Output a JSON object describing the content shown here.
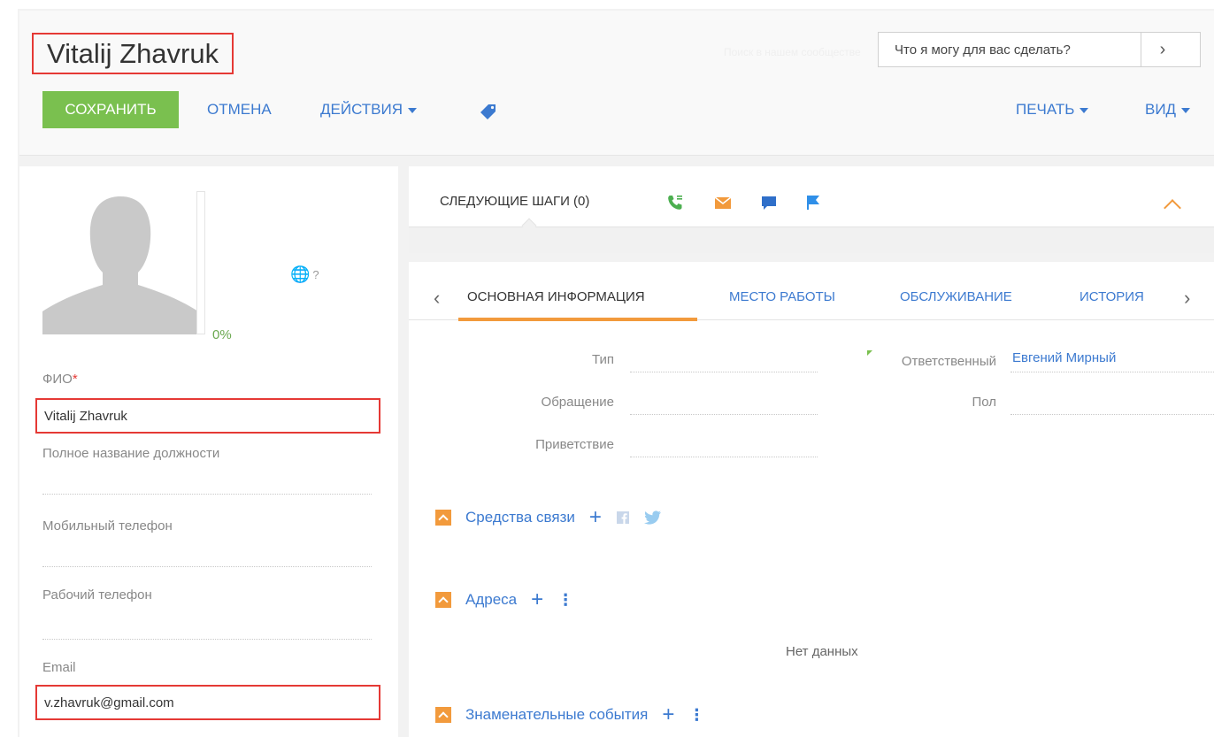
{
  "header": {
    "title": "Vitalij Zhavruk",
    "command_placeholder": "Что я могу для вас сделать?",
    "command_arrow": "›",
    "ghost_text": "Поиск в нашем сообществе",
    "save_label": "СОХРАНИТЬ",
    "cancel_label": "ОТМЕНА",
    "actions_label": "ДЕЙСТВИЯ",
    "print_label": "ПЕЧАТЬ",
    "view_label": "ВИД"
  },
  "profile": {
    "completeness": "0%",
    "completeness_fraction": 0,
    "timezone_hint": "?"
  },
  "left_fields": {
    "fio_label": "ФИО",
    "fio_required": "*",
    "fio_value": "Vitalij Zhavruk",
    "job_label": "Полное название должности",
    "mobile_label": "Мобильный телефон",
    "work_phone_label": "Рабочий телефон",
    "email_label": "Email",
    "email_value": "v.zhavruk@gmail.com"
  },
  "next_steps": {
    "title": "СЛЕДУЮЩИЕ ШАГИ (0)",
    "icons": [
      "phone-icon",
      "email-icon",
      "chat-icon",
      "flag-icon"
    ]
  },
  "tabs": {
    "items": [
      "ОСНОВНАЯ ИНФОРМАЦИЯ",
      "МЕСТО РАБОТЫ",
      "ОБСЛУЖИВАНИЕ",
      "ИСТОРИЯ"
    ],
    "active_index": 0,
    "prev": "‹",
    "next": "›"
  },
  "main_fields": {
    "type_label": "Тип",
    "address_form_label": "Обращение",
    "greeting_label": "Приветствие",
    "owner_label": "Ответственный",
    "owner_value": "Евгений Мирный",
    "gender_label": "Пол"
  },
  "sections": {
    "communication": "Средства связи",
    "addresses": "Адреса",
    "no_data": "Нет данных",
    "events": "Знаменательные события",
    "plus": "+",
    "more": "⋮"
  },
  "colors": {
    "accent_green": "#7ac04f",
    "link_blue": "#3c7ad0",
    "accent_orange": "#f29a3c",
    "highlight_red": "#e53935"
  }
}
